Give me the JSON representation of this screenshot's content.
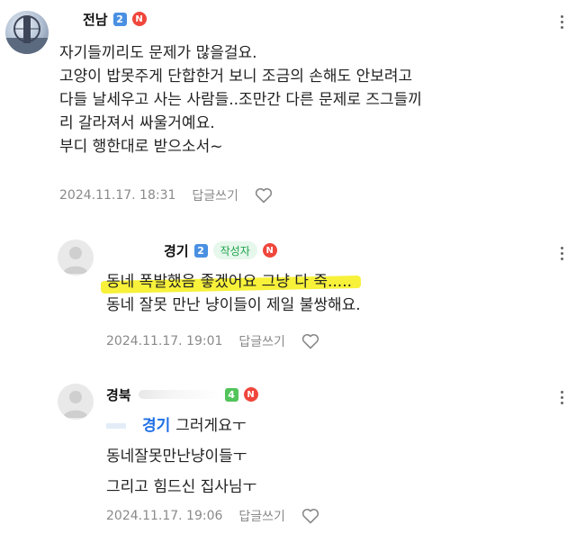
{
  "comments": [
    {
      "nickname": "전남",
      "level": "2",
      "level_color": "#4a90e2",
      "new_badge": "N",
      "lines": [
        "자기들끼리도 문제가 많을걸요.",
        "고양이 밥못주게 단합한거 보니 조금의 손해도 안보려고",
        "다들 날세우고 사는 사람들..조만간 다른 문제로 즈그들끼",
        "리 갈라져서 싸울거예요.",
        "부디 행한대로 받으소서~"
      ],
      "timestamp": "2024.11.17. 18:31",
      "reply_label": "답글쓰기",
      "avatar_icon": "profile-photo"
    },
    {
      "nickname": "경기",
      "level": "2",
      "level_color": "#4a90e2",
      "author_badge": "작성자",
      "new_badge": "N",
      "lines": [
        "동네 폭발했음 좋겠어요 그냥 다 죽.....",
        "동네 잘못 만난 냥이들이 제일 불쌍해요."
      ],
      "timestamp": "2024.11.17. 19:01",
      "reply_label": "답글쓰기",
      "avatar_icon": "default-avatar-icon",
      "highlight_color": "#f7f13a"
    },
    {
      "nickname": "경북",
      "level": "4",
      "level_color": "#52c45a",
      "new_badge": "N",
      "mention": "경기",
      "lines": [
        "그러게요ㅜ",
        "동네잘못만난냥이들ㅜ",
        "그리고 힘드신 집사님ㅜ"
      ],
      "timestamp": "2024.11.17. 19:06",
      "reply_label": "답글쓰기",
      "avatar_icon": "default-avatar-icon"
    }
  ],
  "colors": {
    "new_badge": "#f0463c",
    "author_badge_bg": "#e6f7ec",
    "author_badge_text": "#1fa34a",
    "mention": "#1f6fe5",
    "meta_text": "#8a8a8a"
  }
}
